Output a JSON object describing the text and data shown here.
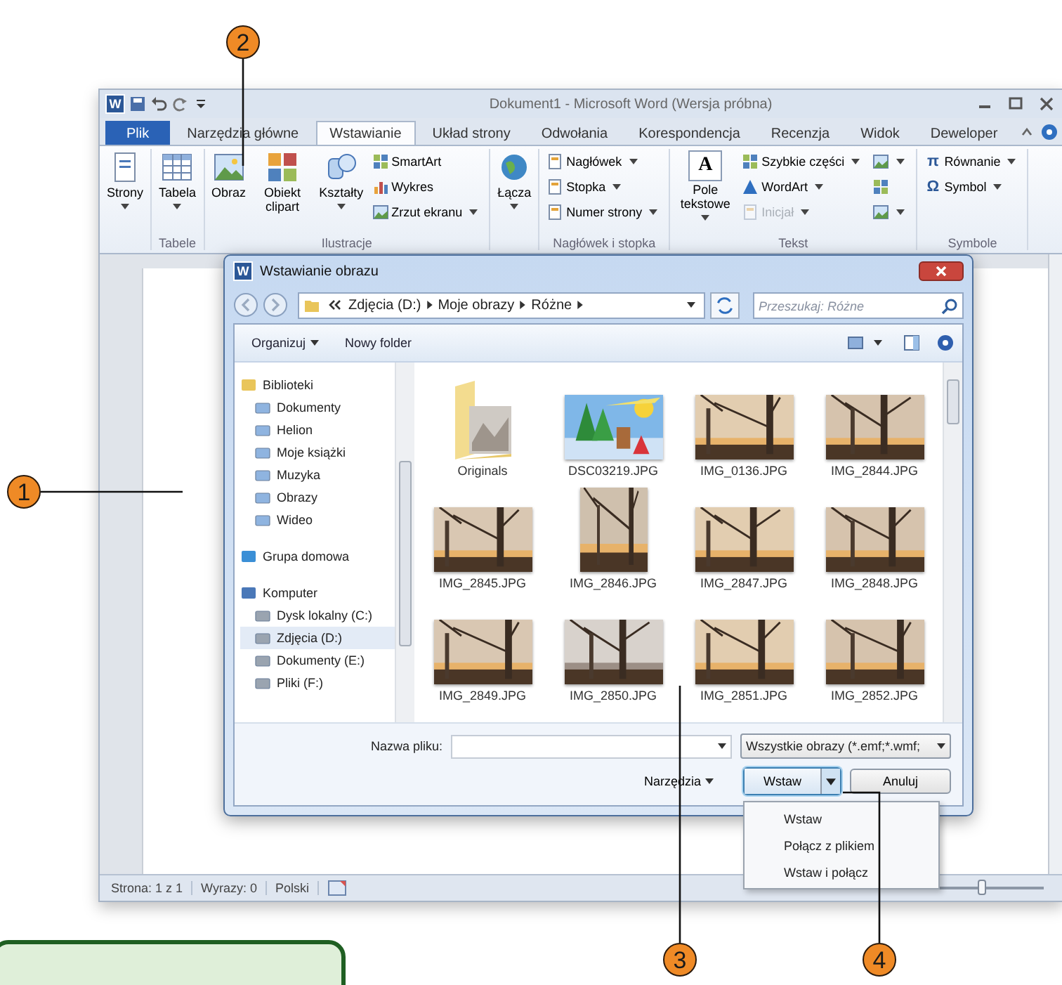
{
  "callouts": [
    {
      "number": "2"
    },
    {
      "number": "1"
    },
    {
      "number": "3"
    },
    {
      "number": "4"
    }
  ],
  "word": {
    "app_badge": "W",
    "title": "Dokument1 - Microsoft Word (Wersja próbna)",
    "tabs": [
      {
        "label": "Plik",
        "kind": "file",
        "selected": false
      },
      {
        "label": "Narzędzia główne",
        "kind": "tab",
        "selected": false
      },
      {
        "label": "Wstawianie",
        "kind": "tab",
        "selected": true
      },
      {
        "label": "Układ strony",
        "kind": "tab",
        "selected": false
      },
      {
        "label": "Odwołania",
        "kind": "tab",
        "selected": false
      },
      {
        "label": "Korespondencja",
        "kind": "tab",
        "selected": false
      },
      {
        "label": "Recenzja",
        "kind": "tab",
        "selected": false
      },
      {
        "label": "Widok",
        "kind": "tab",
        "selected": false
      },
      {
        "label": "Deweloper",
        "kind": "tab",
        "selected": false
      }
    ],
    "ribbon_groups": [
      {
        "buttons": [
          {
            "label": "Strony",
            "kind": "large",
            "dropdown": true,
            "disabled": false
          }
        ]
      },
      {
        "label": "Tabele",
        "buttons": [
          {
            "label": "Tabela",
            "kind": "large",
            "dropdown": true,
            "disabled": false
          }
        ]
      },
      {
        "label": "Ilustracje",
        "buttons": [
          {
            "label": "Obraz",
            "kind": "large",
            "dropdown": false,
            "disabled": false
          },
          {
            "label": "Obiekt clipart",
            "kind": "large",
            "dropdown": false,
            "disabled": false
          },
          {
            "label": "Kształty",
            "kind": "large",
            "dropdown": true,
            "disabled": false
          },
          {
            "label": "SmartArt",
            "kind": "small",
            "dropdown": false,
            "disabled": false
          },
          {
            "label": "Wykres",
            "kind": "small",
            "dropdown": false,
            "disabled": false
          },
          {
            "label": "Zrzut ekranu",
            "kind": "small",
            "dropdown": true,
            "disabled": false
          }
        ]
      },
      {
        "buttons": [
          {
            "label": "Łącza",
            "kind": "large",
            "dropdown": true,
            "disabled": false
          }
        ]
      },
      {
        "label": "Nagłówek i stopka",
        "buttons": [
          {
            "label": "Nagłówek",
            "kind": "small",
            "dropdown": true,
            "disabled": false
          },
          {
            "label": "Stopka",
            "kind": "small",
            "dropdown": true,
            "disabled": false
          },
          {
            "label": "Numer strony",
            "kind": "small",
            "dropdown": true,
            "disabled": false
          }
        ]
      },
      {
        "label": "Tekst",
        "buttons": [
          {
            "label": "Pole tekstowe",
            "glyph": "A",
            "kind": "large",
            "dropdown": true,
            "disabled": false
          },
          {
            "label": "Szybkie części",
            "kind": "small",
            "dropdown": true,
            "disabled": false
          },
          {
            "label": "WordArt",
            "kind": "small",
            "dropdown": true,
            "disabled": false
          },
          {
            "label": "Inicjał",
            "kind": "small",
            "dropdown": true,
            "disabled": true
          },
          {
            "kind": "small",
            "dropdown": true,
            "disabled": false
          },
          {
            "kind": "small",
            "dropdown": false,
            "disabled": false
          },
          {
            "kind": "small",
            "dropdown": true,
            "disabled": false
          }
        ]
      },
      {
        "label": "Symbole",
        "buttons": [
          {
            "label": "Równanie",
            "glyph": "π",
            "kind": "small",
            "dropdown": true,
            "disabled": false
          },
          {
            "label": "Symbol",
            "glyph": "Ω",
            "kind": "small",
            "dropdown": true,
            "disabled": false
          }
        ]
      }
    ],
    "status_bar": [
      "Strona: 1 z 1",
      "Wyrazy: 0",
      "Polski"
    ],
    "zoom": {
      "level": 0.6
    }
  },
  "dialog": {
    "app_badge": "W",
    "title": "Wstawianie obrazu",
    "path": [
      "Zdjęcia (D:)",
      "Moje obrazy",
      "Różne"
    ],
    "search": {
      "placeholder": "Przeszukaj: Różne"
    },
    "toolbar": [
      {
        "label": "Organizuj",
        "dropdown": true
      },
      {
        "label": "Nowy folder",
        "dropdown": false
      }
    ],
    "nav": [
      {
        "label": "Biblioteki",
        "selected": false,
        "children": [
          {
            "label": "Dokumenty",
            "selected": false
          },
          {
            "label": "Helion",
            "selected": false
          },
          {
            "label": "Moje książki",
            "selected": false
          },
          {
            "label": "Muzyka",
            "selected": false
          },
          {
            "label": "Obrazy",
            "selected": false
          },
          {
            "label": "Wideo",
            "selected": false
          }
        ]
      },
      {
        "label": "Grupa domowa",
        "selected": false
      },
      {
        "label": "Komputer",
        "selected": false,
        "children": [
          {
            "label": "Dysk lokalny (C:)",
            "selected": false
          },
          {
            "label": "Zdjęcia (D:)",
            "selected": true
          },
          {
            "label": "Dokumenty (E:)",
            "selected": false
          },
          {
            "label": "Pliki (F:)",
            "selected": false
          }
        ]
      }
    ],
    "files": [
      {
        "name": "Originals",
        "kind": "folder"
      },
      {
        "name": "DSC03219.JPG",
        "kind": "picture"
      },
      {
        "name": "IMG_0136.JPG",
        "kind": "picture"
      },
      {
        "name": "IMG_2844.JPG",
        "kind": "picture"
      },
      {
        "name": "IMG_2845.JPG",
        "kind": "picture"
      },
      {
        "name": "IMG_2846.JPG",
        "kind": "picture"
      },
      {
        "name": "IMG_2847.JPG",
        "kind": "picture"
      },
      {
        "name": "IMG_2848.JPG",
        "kind": "picture"
      },
      {
        "name": "IMG_2849.JPG",
        "kind": "picture"
      },
      {
        "name": "IMG_2850.JPG",
        "kind": "picture"
      },
      {
        "name": "IMG_2851.JPG",
        "kind": "picture"
      },
      {
        "name": "IMG_2852.JPG",
        "kind": "picture"
      }
    ],
    "filename": {
      "label": "Nazwa pliku:"
    },
    "file_type": "Wszystkie obrazy (*.emf;*.wmf;",
    "tools": "Narzędzia",
    "buttons": [
      {
        "label": "Wstaw",
        "kind": "split",
        "focused": true
      },
      {
        "label": "Anuluj",
        "kind": "plain",
        "focused": false
      }
    ],
    "split_menu": [
      "Wstaw",
      "Połącz z plikiem",
      "Wstaw i połącz"
    ]
  }
}
